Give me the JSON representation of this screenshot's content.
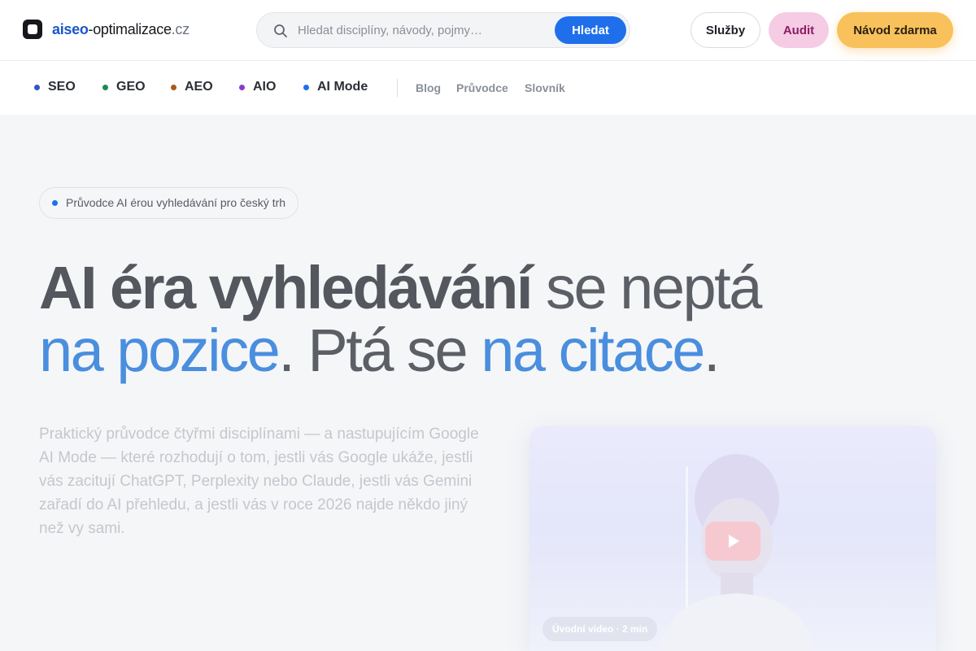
{
  "header": {
    "logo_part1": "aiseo",
    "logo_part2": "-optimalizace",
    "logo_part3": ".cz",
    "search_placeholder": "Hledat disciplíny, návody, pojmy…",
    "search_button": "Hledat",
    "services_label": "Služby",
    "audit_label": "Audit",
    "guide_label": "Návod zdarma"
  },
  "disciplines": [
    {
      "label": "SEO",
      "color": "#2f55c9"
    },
    {
      "label": "GEO",
      "color": "#1e8a4d"
    },
    {
      "label": "AEO",
      "color": "#a85a17"
    },
    {
      "label": "AIO",
      "color": "#8a3cc9"
    },
    {
      "label": "AI Mode",
      "color": "#1f6feb"
    }
  ],
  "sublinks": [
    "Blog",
    "Průvodce",
    "Slovník"
  ],
  "hero": {
    "pill": "Průvodce AI érou vyhledávání pro český trh",
    "headline": {
      "strong": "AI éra vyhledávání",
      "light1": " se neptá",
      "accent1": "na pozice",
      "light2": ". Ptá se ",
      "accent2": "na citace",
      "light3": "."
    },
    "lead": "Praktický průvodce čtyřmi disciplínami — a nastupujícím Google AI Mode — které rozhodují o tom, jestli vás Google ukáže, jestli vás zacitují ChatGPT, Perplexity nebo Claude, jestli vás Gemini zařadí do AI přehledu, a jestli vás v roce 2026 najde někdo jiný než vy sami.",
    "video_chip": "Úvodní video · 2 min"
  },
  "colors": {
    "accent": "#1f6feb",
    "headline_accent": "#4a8ede",
    "audit_bg": "#f6cbe4",
    "guide_bg": "#f9c15b"
  }
}
